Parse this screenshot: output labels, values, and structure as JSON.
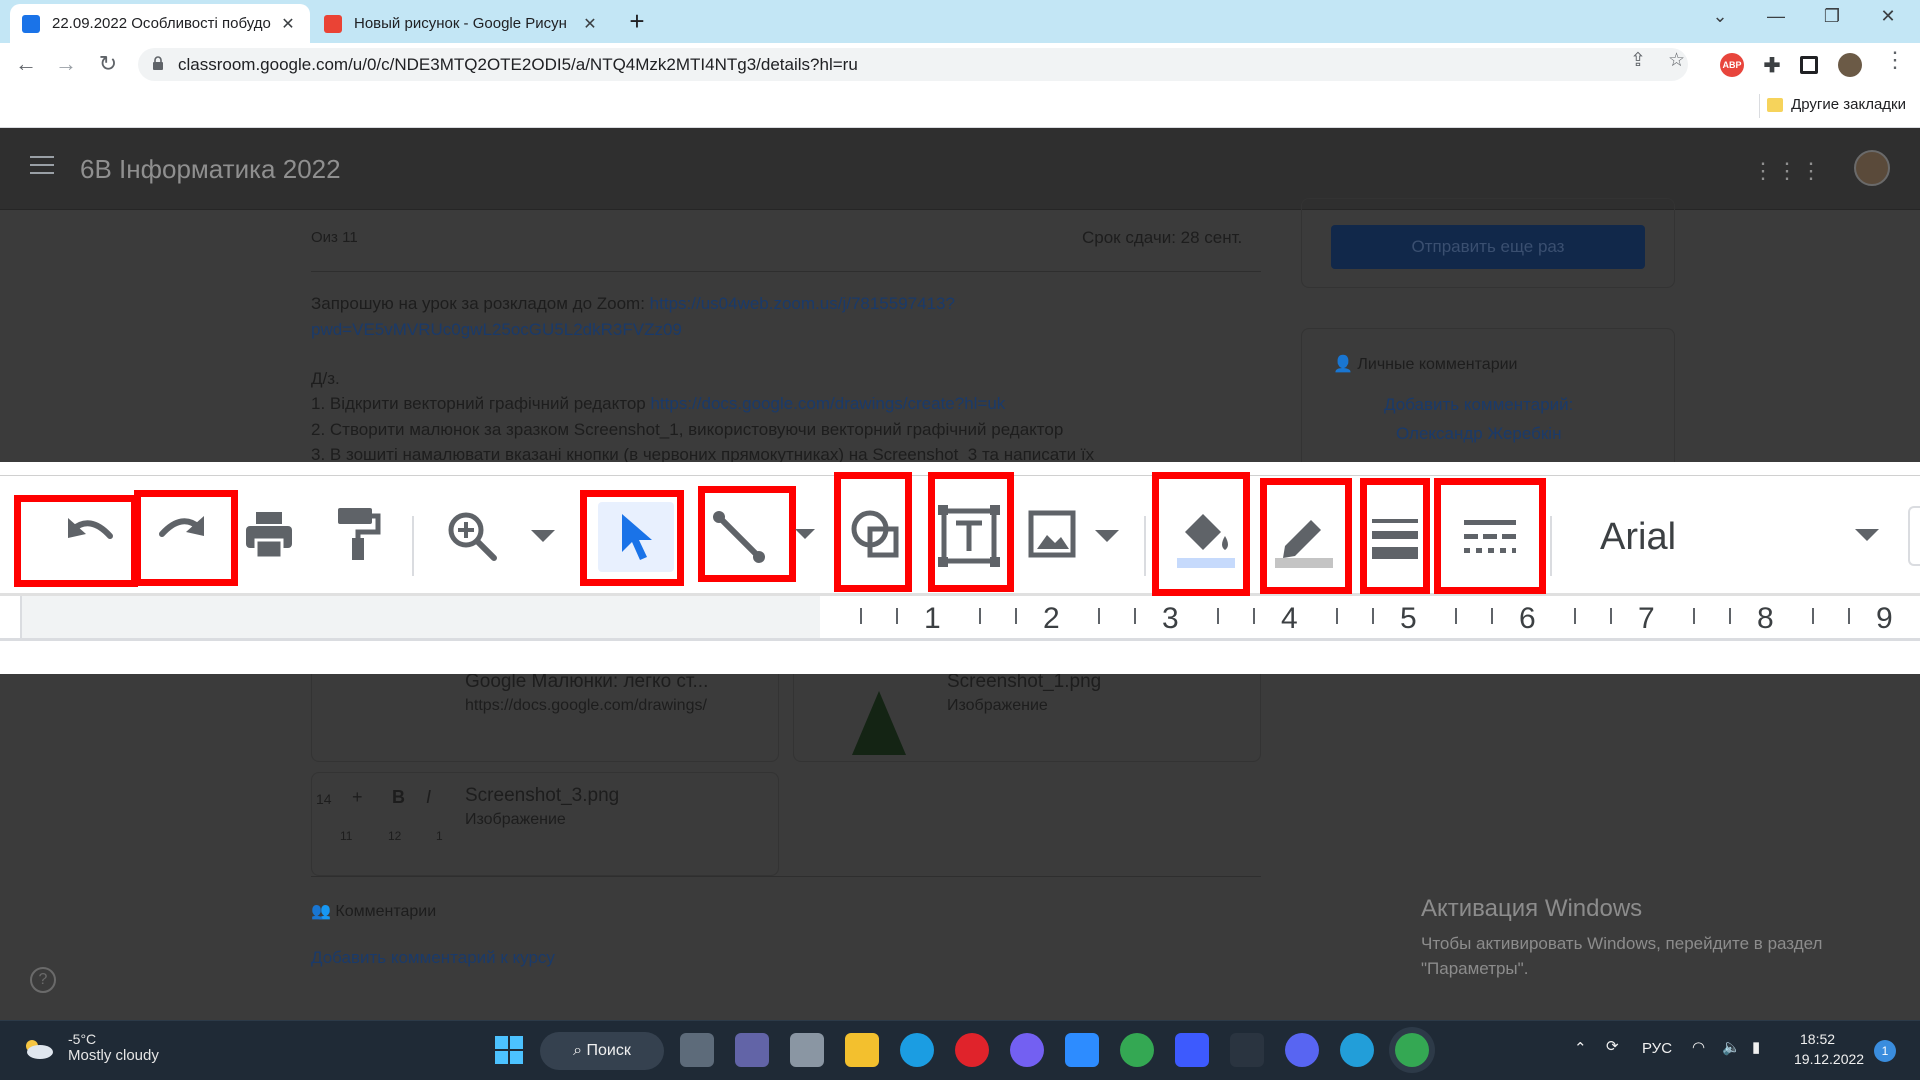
{
  "browser": {
    "tabs": [
      {
        "title": "22.09.2022 Особливості побудо",
        "active": true
      },
      {
        "title": "Новый рисунок - Google Рисун",
        "active": false
      }
    ],
    "url": "classroom.google.com/u/0/c/NDE3MTQ2OTE2ODI5/a/NTQ4Mzk2MTI4NTg3/details?hl=ru",
    "bookmarks_folder": "Другие закладки",
    "ext_abp": "ABP"
  },
  "classroom": {
    "course_title": "6В Інформатика 2022",
    "points": "Оиз 11",
    "due": "Срок сдачи: 28 сент.",
    "line1_prefix": "Запрошую на урок за розкладом  до Zoom: ",
    "line1_link": "https://us04web.zoom.us/j/7815597413?",
    "line2_link": "pwd=VE5vMVRUc0gwL25ocGU5L2dkR3FVZz09",
    "hw_title": "Д/з.",
    "hw1_prefix": "1. Відкрити векторний графічний редактор ",
    "hw1_link": "https://docs.google.com/drawings/create?hl=uk",
    "hw2": "2. Створити малюнок за зразком Screenshot_1,  використовуючи векторний графічний редактор",
    "hw3": "3. В зошиті намалювати вказані кнопки (в червоних прямокутниках)  на Screenshot_3 та написати їх",
    "resend_button": "Отправить еще раз",
    "private_comments_label": "Личные комментарии",
    "add_comment_link": "Добавить комментарий:",
    "teacher_name": "Олександр Жеребкін",
    "att1_title": "Google Малюнки: легко ст...",
    "att1_sub": "https://docs.google.com/drawings/",
    "att2_title": "Screenshot_1.png",
    "att2_sub": "Изображение",
    "att3_title": "Screenshot_3.png",
    "att3_sub": "Изображение",
    "att3_thumb": {
      "num14": "14",
      "plus": "+",
      "bold": "B",
      "italic": "I",
      "r11": "11",
      "r12": "12",
      "r1": "1"
    },
    "comments_label": "Комментарии",
    "add_course_comment": "Добавить комментарий к курсу"
  },
  "toolbar": {
    "font_name": "Arial",
    "ruler_numbers": [
      "1",
      "2",
      "3",
      "4",
      "5",
      "6",
      "7",
      "8",
      "9"
    ],
    "highlight_color": "#ff0000"
  },
  "activation": {
    "heading": "Активация Windows",
    "line1": "Чтобы активировать Windows, перейдите в раздел",
    "line2": "\"Параметры\"."
  },
  "taskbar": {
    "temperature": "-5°C",
    "weather": "Mostly cloudy",
    "search_label": "Поиск",
    "language": "РУС",
    "time": "18:52",
    "date": "19.12.2022",
    "notifications": "1"
  }
}
